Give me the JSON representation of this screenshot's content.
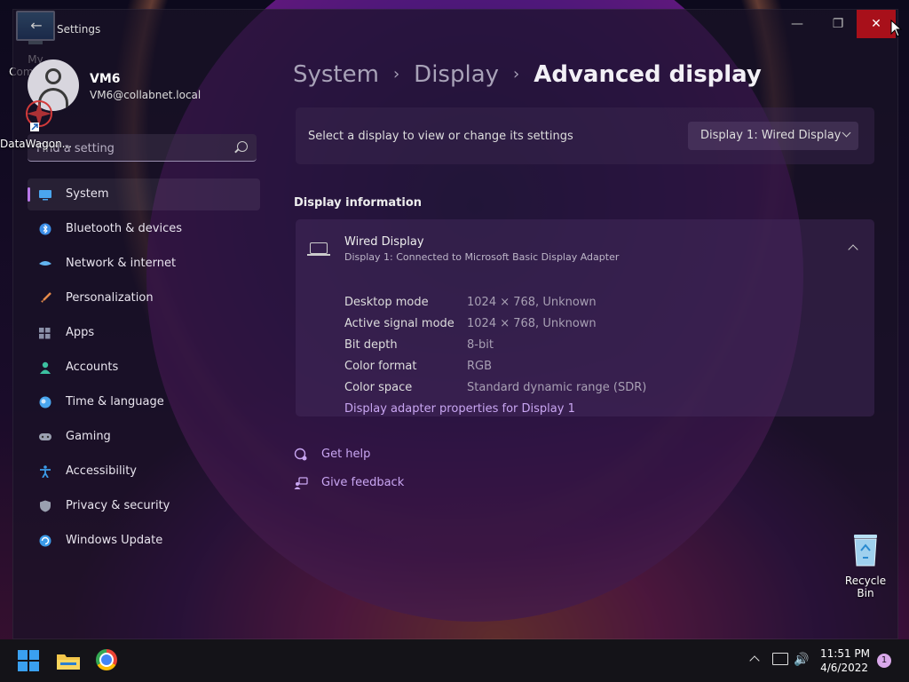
{
  "desktop": {
    "icons": [
      {
        "label": "My Computer"
      },
      {
        "label": "DataWagon..."
      },
      {
        "label": "Recycle Bin"
      }
    ]
  },
  "window": {
    "title": "Settings",
    "back_glyph": "←",
    "min_glyph": "—",
    "max_glyph": "❐",
    "close_glyph": "✕"
  },
  "profile": {
    "name": "VM6",
    "email": "VM6@collabnet.local"
  },
  "search": {
    "placeholder": "Find a setting"
  },
  "nav": {
    "items": [
      {
        "label": "System",
        "icon": "system-icon",
        "color": "#4aa6ee",
        "active": true
      },
      {
        "label": "Bluetooth & devices",
        "icon": "bluetooth-icon",
        "color": "#3b8ee8"
      },
      {
        "label": "Network & internet",
        "icon": "wifi-icon",
        "color": "#62b4f0"
      },
      {
        "label": "Personalization",
        "icon": "brush-icon",
        "color": "#e58a4a"
      },
      {
        "label": "Apps",
        "icon": "apps-icon",
        "color": "#8a90a8"
      },
      {
        "label": "Accounts",
        "icon": "person-icon",
        "color": "#3cc0a0"
      },
      {
        "label": "Time & language",
        "icon": "globe-icon",
        "color": "#4aa6ee"
      },
      {
        "label": "Gaming",
        "icon": "gamepad-icon",
        "color": "#9aa0b0"
      },
      {
        "label": "Accessibility",
        "icon": "accessibility-icon",
        "color": "#3b9be8"
      },
      {
        "label": "Privacy & security",
        "icon": "shield-icon",
        "color": "#9aa0b0"
      },
      {
        "label": "Windows Update",
        "icon": "update-icon",
        "color": "#3b9be8"
      }
    ]
  },
  "breadcrumb": {
    "items": [
      "System",
      "Display"
    ],
    "separator": "›",
    "current": "Advanced display"
  },
  "selector": {
    "text": "Select a display to view or change its settings",
    "value": "Display 1: Wired Display"
  },
  "display_info": {
    "section_title": "Display information",
    "title": "Wired Display",
    "subtitle": "Display 1: Connected to Microsoft Basic Display Adapter",
    "properties": [
      {
        "key": "Desktop mode",
        "value": "1024 × 768, Unknown"
      },
      {
        "key": "Active signal mode",
        "value": "1024 × 768, Unknown"
      },
      {
        "key": "Bit depth",
        "value": "8-bit"
      },
      {
        "key": "Color format",
        "value": "RGB"
      },
      {
        "key": "Color space",
        "value": "Standard dynamic range (SDR)"
      }
    ],
    "adapter_link": "Display adapter properties for Display 1"
  },
  "help": {
    "get_help": "Get help",
    "feedback": "Give feedback"
  },
  "taskbar": {
    "time": "11:51 PM",
    "date": "4/6/2022",
    "notification_count": "1",
    "volume_glyph": "🔊"
  },
  "colors": {
    "accent": "#c9a6f2",
    "close_button": "#a8101a",
    "start_blue": "#3aa0f0"
  }
}
